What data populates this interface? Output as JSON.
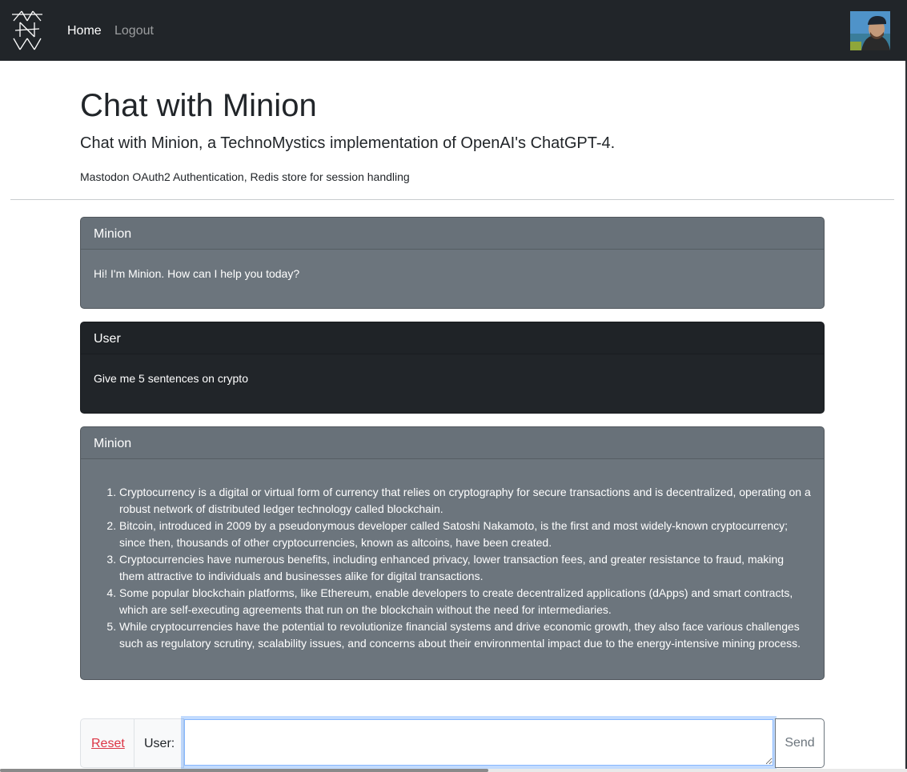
{
  "nav": {
    "home_label": "Home",
    "logout_label": "Logout"
  },
  "header": {
    "title": "Chat with Minion",
    "lead": "Chat with Minion, a TechnoMystics implementation of OpenAI's ChatGPT-4.",
    "subnote": "Mastodon OAuth2 Authentication, Redis store for session handling"
  },
  "messages": [
    {
      "sender": "Minion",
      "text": "Hi! I'm Minion. How can I help you today?"
    },
    {
      "sender": "User",
      "text": "Give me 5 sentences on crypto"
    },
    {
      "sender": "Minion",
      "items": [
        "Cryptocurrency is a digital or virtual form of currency that relies on cryptography for secure transactions and is decentralized, operating on a robust network of distributed ledger technology called blockchain.",
        "Bitcoin, introduced in 2009 by a pseudonymous developer called Satoshi Nakamoto, is the first and most widely-known cryptocurrency; since then, thousands of other cryptocurrencies, known as altcoins, have been created.",
        "Cryptocurrencies have numerous benefits, including enhanced privacy, lower transaction fees, and greater resistance to fraud, making them attractive to individuals and businesses alike for digital transactions.",
        "Some popular blockchain platforms, like Ethereum, enable developers to create decentralized applications (dApps) and smart contracts, which are self-executing agreements that run on the blockchain without the need for intermediaries.",
        "While cryptocurrencies have the potential to revolutionize financial systems and drive economic growth, they also face various challenges such as regulatory scrutiny, scalability issues, and concerns about their environmental impact due to the energy-intensive mining process."
      ]
    }
  ],
  "composer": {
    "reset_label": "Reset",
    "user_label": "User:",
    "input_value": "",
    "send_label": "Send"
  },
  "colors": {
    "navbar": "#212529",
    "bot_card": "#6c757d",
    "user_card": "#212529",
    "reset_link": "#dc3545"
  }
}
